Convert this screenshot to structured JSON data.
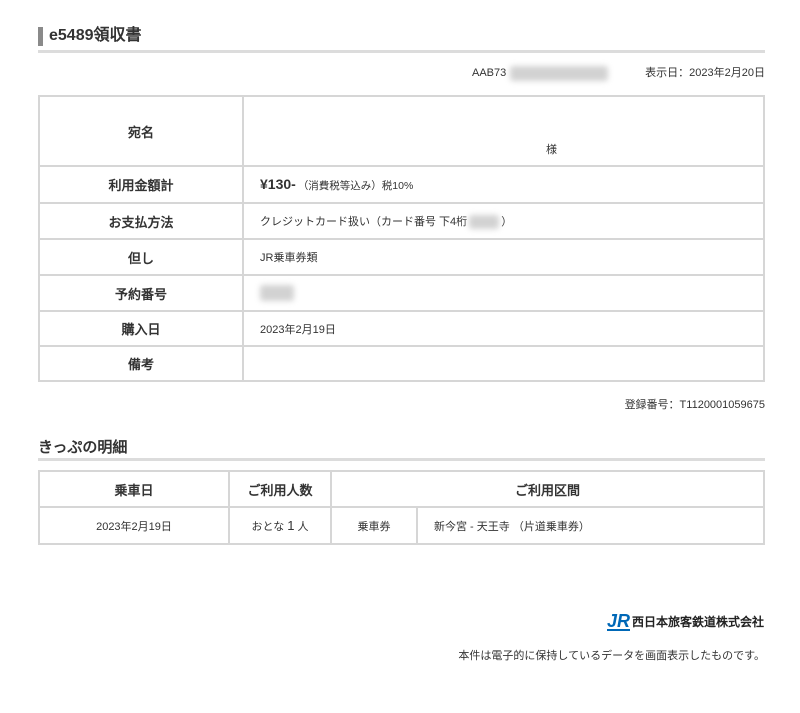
{
  "header": {
    "title": "e5489領収書"
  },
  "meta": {
    "receipt_number_visible": "AAB73",
    "display_date": "表示日：2023年2月20日"
  },
  "receipt": {
    "addressee": {
      "label": "宛名",
      "suffix": "様"
    },
    "total": {
      "label": "利用金額計",
      "amount": "¥130-",
      "tax_note": "（消費税等込み）税10%"
    },
    "payment": {
      "label": "お支払方法",
      "method": "クレジットカード扱い（カード番号 下4桁",
      "close": "）"
    },
    "proviso": {
      "label": "但し",
      "value": "JR乗車券類"
    },
    "reservation": {
      "label": "予約番号"
    },
    "purchase_date": {
      "label": "購入日",
      "value": "2023年2月19日"
    },
    "remarks": {
      "label": "備考"
    }
  },
  "registration_number": "登録番号：T1120001059675",
  "ticket_details": {
    "heading": "きっぷの明細",
    "columns": {
      "date": "乗車日",
      "passengers": "ご利用人数",
      "section": "ご利用区間"
    },
    "rows": [
      {
        "date": "2023年2月19日",
        "passenger_type": "おとな",
        "passenger_count": "1",
        "passenger_unit": "人",
        "ticket_type": "乗車券",
        "route": "新今宮 - 天王寺 （片道乗車券）"
      }
    ]
  },
  "footer": {
    "logo_text": "JR",
    "company": "西日本旅客鉄道株式会社",
    "notice": "本件は電子的に保持しているデータを画面表示したものです。"
  },
  "icons": {
    "logo": "jr-west-logo"
  },
  "colors": {
    "text": "#333333",
    "border": "#d6d6d6",
    "rule": "#dcdcdc",
    "title_bar": "#8a8a8a",
    "brand": "#0068b7"
  }
}
